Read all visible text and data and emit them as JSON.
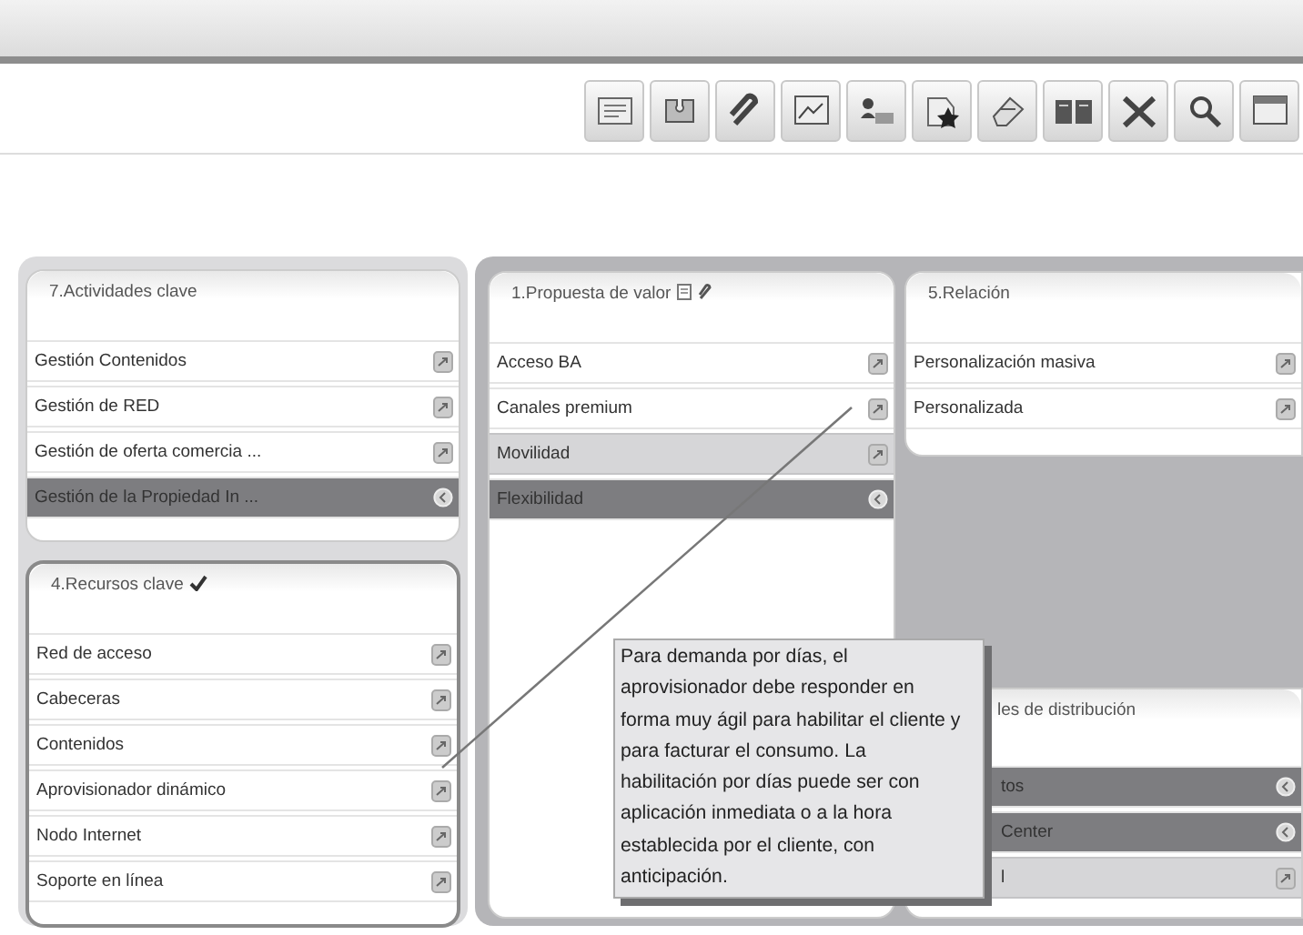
{
  "left_cards": [
    {
      "title": "7.Actividades clave",
      "items": [
        {
          "label": "Gestión Contenidos",
          "selected": false,
          "shaded": false
        },
        {
          "label": "Gestión de RED",
          "selected": false,
          "shaded": false
        },
        {
          "label": "Gestión de oferta comercia ...",
          "selected": false,
          "shaded": false
        },
        {
          "label": "Gestión de la Propiedad In ...",
          "selected": true,
          "shaded": false
        }
      ]
    },
    {
      "title": "4.Recursos clave",
      "checked": true,
      "items": [
        {
          "label": "Red de acceso",
          "selected": false,
          "shaded": false
        },
        {
          "label": "Cabeceras",
          "selected": false,
          "shaded": false
        },
        {
          "label": "Contenidos",
          "selected": false,
          "shaded": false
        },
        {
          "label": "Aprovisionador dinámico",
          "selected": false,
          "shaded": false
        },
        {
          "label": "Nodo Internet",
          "selected": false,
          "shaded": false
        },
        {
          "label": "Soporte en línea",
          "selected": false,
          "shaded": false
        }
      ]
    }
  ],
  "value_card": {
    "title": "1.Propuesta de valor",
    "note": true,
    "link": true,
    "items": [
      {
        "label": "Acceso BA",
        "selected": false,
        "shaded": false
      },
      {
        "label": "Canales premium",
        "selected": false,
        "shaded": false
      },
      {
        "label": "Movilidad",
        "selected": false,
        "shaded": true
      },
      {
        "label": "Flexibilidad",
        "selected": true,
        "shaded": false
      }
    ]
  },
  "relation_card": {
    "title": "5.Relación",
    "items": [
      {
        "label": "Personalización masiva",
        "selected": false,
        "shaded": false
      },
      {
        "label": "Personalizada",
        "selected": false,
        "shaded": false
      }
    ]
  },
  "channel_card": {
    "title": "les de distribución",
    "items": [
      {
        "label": "tos",
        "selected": true,
        "shaded": false
      },
      {
        "label": "Center",
        "selected": true,
        "shaded": false
      },
      {
        "label": "l",
        "selected": false,
        "shaded": true
      }
    ]
  },
  "tooltip": {
    "text": "Para demanda por días, el aprovisionador debe responder en forma muy ágil para habilitar el cliente y para facturar el consumo. La habilitación por días puede ser con aplicación inmediata o a la hora establecida por el cliente, con anticipación."
  }
}
